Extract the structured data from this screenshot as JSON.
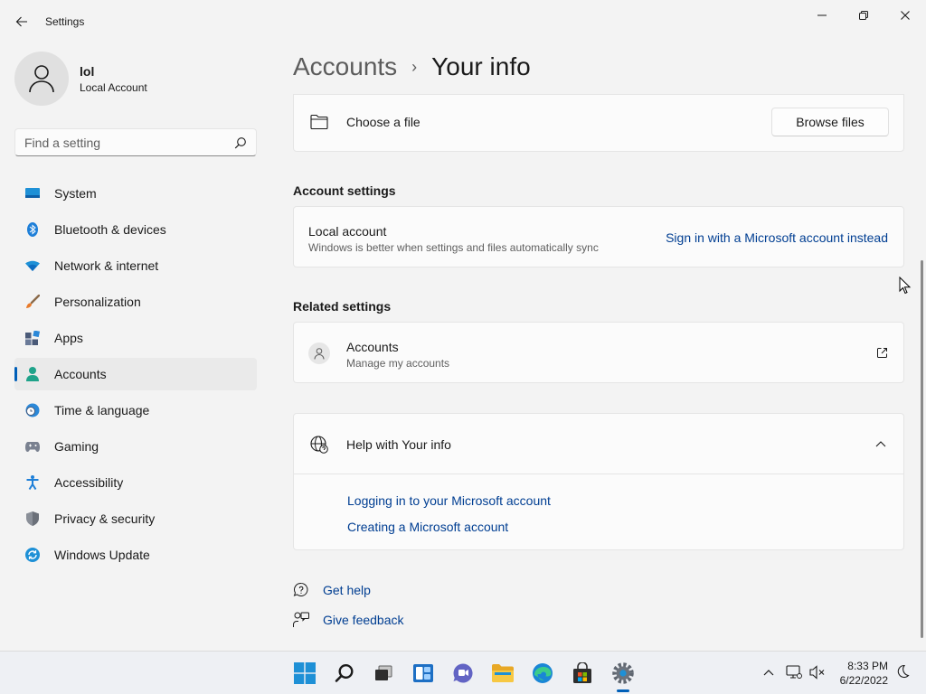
{
  "app": {
    "title": "Settings"
  },
  "user": {
    "name": "lol",
    "account_type": "Local Account"
  },
  "search": {
    "placeholder": "Find a setting"
  },
  "nav": [
    {
      "label": "System",
      "icon": "system-icon"
    },
    {
      "label": "Bluetooth & devices",
      "icon": "bluetooth-icon"
    },
    {
      "label": "Network & internet",
      "icon": "wifi-icon"
    },
    {
      "label": "Personalization",
      "icon": "brush-icon"
    },
    {
      "label": "Apps",
      "icon": "apps-icon"
    },
    {
      "label": "Accounts",
      "icon": "accounts-icon",
      "active": true
    },
    {
      "label": "Time & language",
      "icon": "globe-clock-icon"
    },
    {
      "label": "Gaming",
      "icon": "controller-icon"
    },
    {
      "label": "Accessibility",
      "icon": "accessibility-icon"
    },
    {
      "label": "Privacy & security",
      "icon": "shield-icon"
    },
    {
      "label": "Windows Update",
      "icon": "update-icon"
    }
  ],
  "breadcrumb": {
    "parent": "Accounts",
    "separator": "›",
    "current": "Your info"
  },
  "choose_file": {
    "label": "Choose a file",
    "button": "Browse files"
  },
  "account_settings": {
    "heading": "Account settings",
    "title": "Local account",
    "subtitle": "Windows is better when settings and files automatically sync",
    "action": "Sign in with a Microsoft account instead"
  },
  "related": {
    "heading": "Related settings",
    "title": "Accounts",
    "subtitle": "Manage my accounts"
  },
  "help": {
    "title": "Help with Your info",
    "links": [
      "Logging in to your Microsoft account",
      "Creating a Microsoft account"
    ]
  },
  "footer": {
    "get_help": "Get help",
    "give_feedback": "Give feedback"
  },
  "taskbar": {
    "time": "8:33 PM",
    "date": "6/22/2022"
  },
  "colors": {
    "accent": "#005fb8",
    "link": "#003e92",
    "background": "#f3f3f3",
    "card": "#fbfbfb"
  }
}
